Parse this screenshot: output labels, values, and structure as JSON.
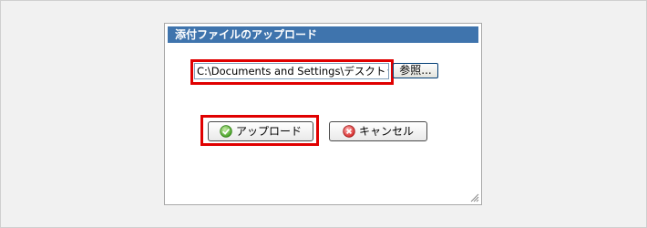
{
  "dialog": {
    "title": "添付ファイルのアップロード",
    "file_input_value": "C:\\Documents and Settings\\デスクトップ",
    "browse_label": "参照...",
    "upload_label": "アップロード",
    "cancel_label": "キャンセル"
  },
  "icons": {
    "upload": "check-circle-icon",
    "cancel": "cancel-circle-icon",
    "resize": "resize-grip-icon"
  },
  "colors": {
    "titlebar": "#3f74ad",
    "highlight": "#e00000"
  }
}
